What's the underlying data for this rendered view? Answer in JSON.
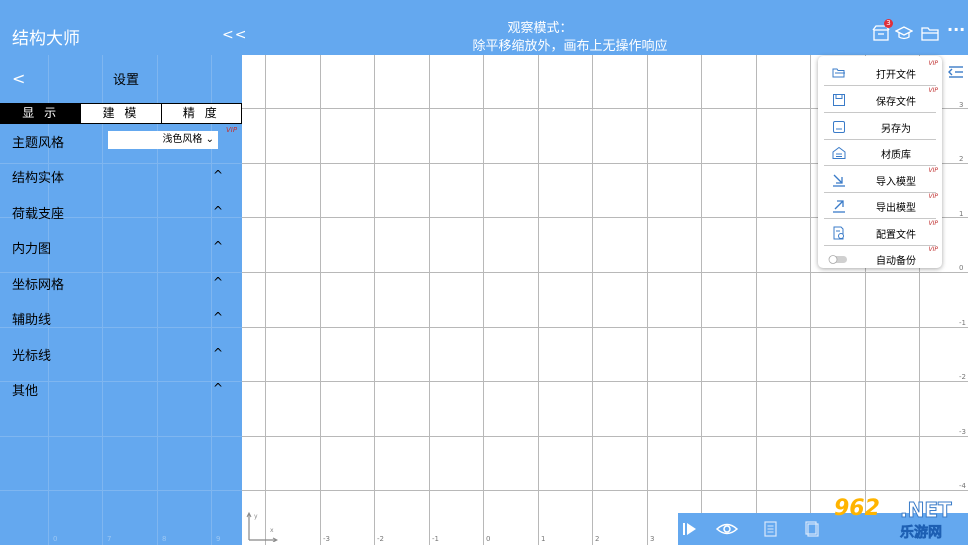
{
  "header": {
    "app_title": "结构大师",
    "collapse": "<<",
    "mode_title": "观察模式：",
    "mode_subtitle": "除平移缩放外，画布上无操作响应",
    "badge_count": "3",
    "more": "···",
    "icons": [
      "shop-icon",
      "graduation-cap-icon",
      "folder-icon",
      "more-icon"
    ]
  },
  "panel": {
    "back": "<",
    "title": "设置",
    "tabs": [
      {
        "label": "显 示",
        "active": true
      },
      {
        "label": "建 模",
        "active": false
      },
      {
        "label": "精 度",
        "active": false
      }
    ],
    "rows": [
      {
        "label": "主题风格",
        "value": "浅色风格",
        "vip": "VIP"
      },
      {
        "label": "结构实体",
        "caret": "^"
      },
      {
        "label": "荷载支座",
        "caret": "^"
      },
      {
        "label": "内力图",
        "caret": "^"
      },
      {
        "label": "坐标网格",
        "caret": "^"
      },
      {
        "label": "辅助线",
        "caret": "^"
      },
      {
        "label": "光标线",
        "caret": "^"
      },
      {
        "label": "其他",
        "caret": "^"
      }
    ],
    "bottom_ticks": [
      "0",
      "7",
      "8",
      "9"
    ]
  },
  "canvas": {
    "x_ticks": [
      "-3",
      "-2",
      "-1",
      "0",
      "1",
      "2",
      "3"
    ],
    "y_ticks": [
      "3",
      "2",
      "1",
      "0",
      "-1",
      "-2",
      "-3",
      "-4"
    ],
    "axis_y": "y",
    "axis_x": "x"
  },
  "menu": {
    "items": [
      {
        "label": "打开文件",
        "icon": "open-folder-icon",
        "vip": "VIP"
      },
      {
        "label": "保存文件",
        "icon": "save-icon",
        "vip": "VIP"
      },
      {
        "label": "另存为",
        "icon": "save-as-icon",
        "vip": ""
      },
      {
        "label": "材质库",
        "icon": "material-library-icon",
        "vip": ""
      },
      {
        "label": "导入模型",
        "icon": "import-icon",
        "vip": "VIP"
      },
      {
        "label": "导出模型",
        "icon": "export-icon",
        "vip": "VIP"
      },
      {
        "label": "配置文件",
        "icon": "config-file-icon",
        "vip": "VIP"
      },
      {
        "label": "自动备份",
        "icon": "toggle-switch",
        "vip": "VIP"
      }
    ]
  },
  "bottom_toolbar": {
    "icons": [
      "play-icon",
      "eye-icon",
      "document-icon",
      "clipboard-icon"
    ]
  },
  "watermark": {
    "number": "962",
    "net": ".NET",
    "cn": "乐游网"
  },
  "colors": {
    "primary": "#64a8ef",
    "grid": "#b8b8b8",
    "vip": "#c03030",
    "icon": "#3a7bc8"
  }
}
